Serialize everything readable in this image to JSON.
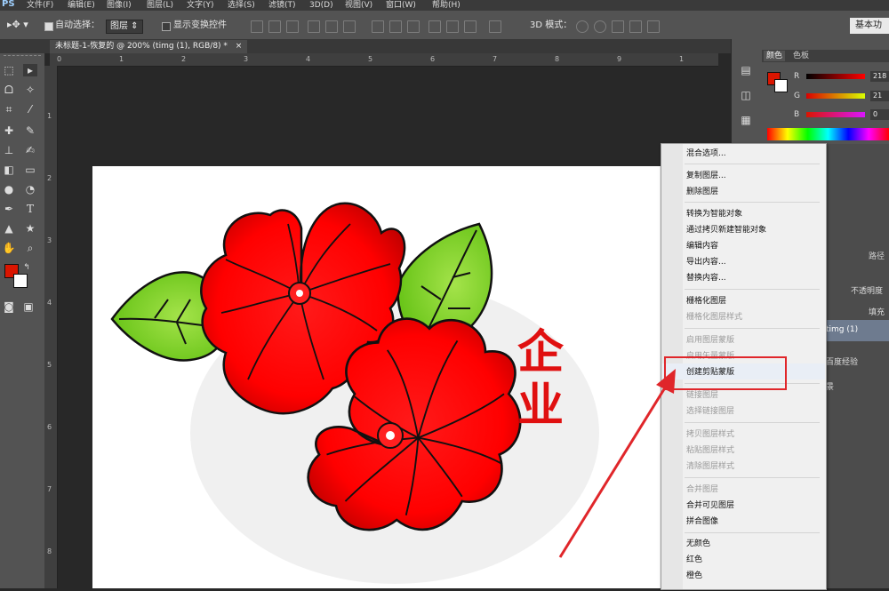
{
  "menubar": {
    "logo": "PS",
    "items": [
      "文件(F)",
      "编辑(E)",
      "图像(I)",
      "图层(L)",
      "文字(Y)",
      "选择(S)",
      "滤镜(T)",
      "3D(D)",
      "视图(V)",
      "窗口(W)",
      "帮助(H)"
    ]
  },
  "options": {
    "auto_select_label": "自动选择：",
    "auto_select_target": "图层",
    "show_transform_label": "显示变换控件",
    "mode_3d_label": "3D 模式：",
    "workspace": "基本功"
  },
  "document": {
    "tab_title": "未标题-1-恢复的 @ 200% (timg (1), RGB/8) *",
    "close": "×"
  },
  "rulers": {
    "top": [
      "0",
      "1",
      "2",
      "3",
      "4",
      "5",
      "6",
      "7",
      "8",
      "9",
      "1"
    ],
    "left": [
      "1",
      "2",
      "3",
      "4",
      "5",
      "6",
      "7",
      "8"
    ]
  },
  "panels": {
    "color_tab": "颜色",
    "swatch_tab": "色板",
    "channels": [
      {
        "label": "R",
        "value": "218"
      },
      {
        "label": "G",
        "value": "21"
      },
      {
        "label": "B",
        "value": "0"
      }
    ],
    "foreground_color": "#da1500",
    "layers_tab": "路径",
    "opacity_label": "不透明度",
    "fill_label": "填充",
    "layer_name": "timg (1)",
    "layer_name_2": "百度经验",
    "layer_name_3": "景"
  },
  "canvas_text": "企业",
  "context_menu": {
    "items": [
      {
        "label": "混合选项...",
        "disabled": false
      },
      {
        "label": "复制图层...",
        "disabled": false
      },
      {
        "label": "删除图层",
        "disabled": false
      },
      {
        "label": "转换为智能对象",
        "disabled": false
      },
      {
        "label": "通过拷贝新建智能对象",
        "disabled": false
      },
      {
        "label": "编辑内容",
        "disabled": false
      },
      {
        "label": "导出内容...",
        "disabled": false
      },
      {
        "label": "替换内容...",
        "disabled": false
      },
      {
        "label": "栅格化图层",
        "disabled": false
      },
      {
        "label": "栅格化图层样式",
        "disabled": true
      },
      {
        "label": "启用图层蒙版",
        "disabled": true
      },
      {
        "label": "启用矢量蒙版",
        "disabled": true
      },
      {
        "label": "创建剪贴蒙版",
        "disabled": false
      },
      {
        "label": "链接图层",
        "disabled": true
      },
      {
        "label": "选择链接图层",
        "disabled": true
      },
      {
        "label": "拷贝图层样式",
        "disabled": true
      },
      {
        "label": "粘贴图层样式",
        "disabled": true
      },
      {
        "label": "清除图层样式",
        "disabled": true
      },
      {
        "label": "合并图层",
        "disabled": true
      },
      {
        "label": "合并可见图层",
        "disabled": false
      },
      {
        "label": "拼合图像",
        "disabled": false
      },
      {
        "label": "无颜色",
        "disabled": false
      },
      {
        "label": "红色",
        "disabled": false
      },
      {
        "label": "橙色",
        "disabled": false
      }
    ]
  },
  "colors": {
    "annotation_red": "#e0262a",
    "petal_red": "#ff0000",
    "leaf_green": "#7ed321"
  }
}
